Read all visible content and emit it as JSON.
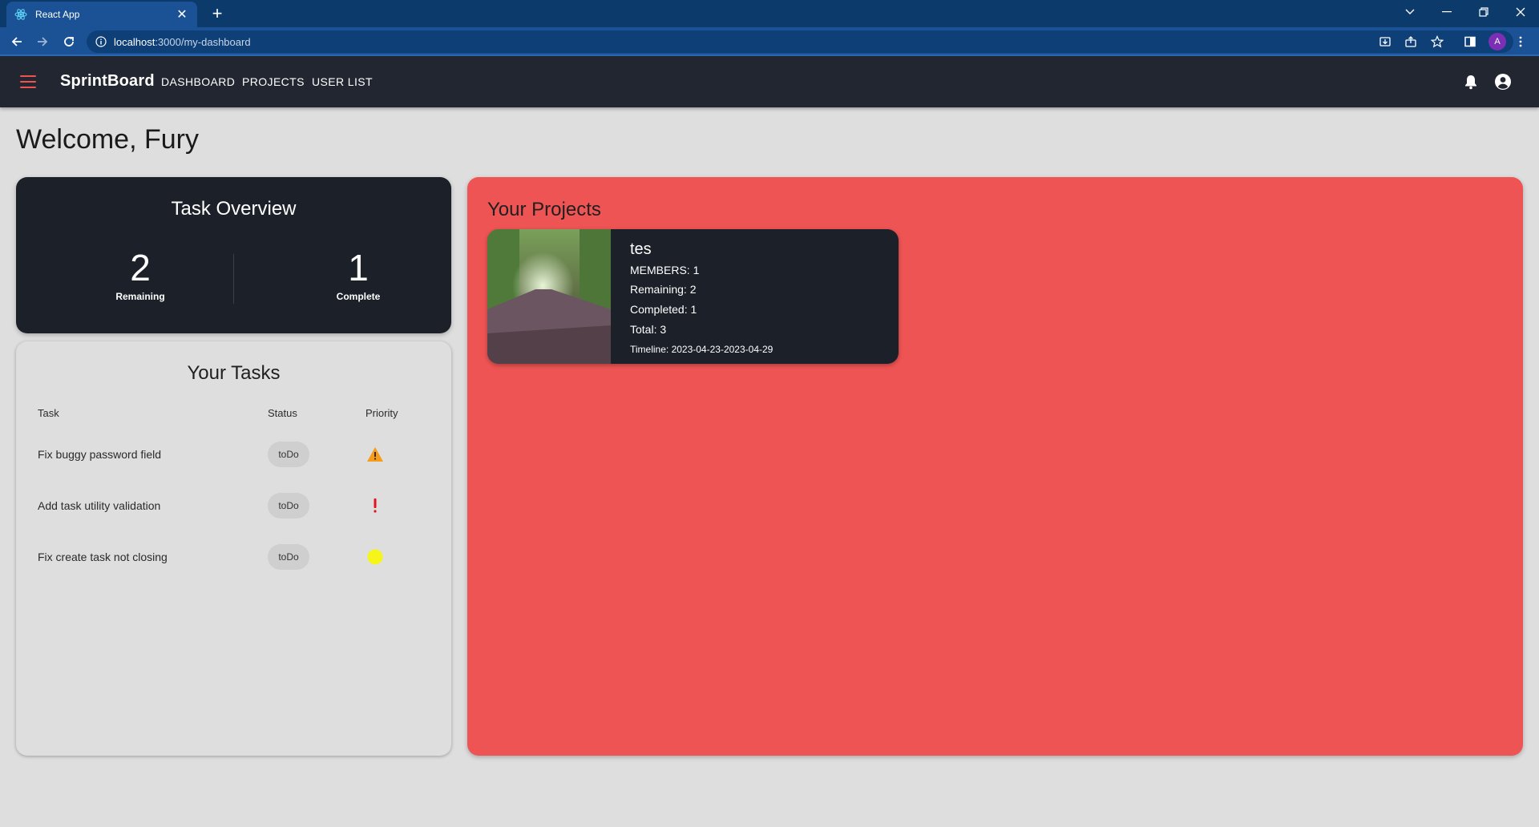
{
  "browser": {
    "tab_title": "React App",
    "url_host": "localhost",
    "url_path": ":3000/my-dashboard",
    "profile_initial": "A"
  },
  "appbar": {
    "brand": "SprintBoard",
    "nav": [
      "DASHBOARD",
      "PROJECTS",
      "USER LIST"
    ]
  },
  "welcome": "Welcome, Fury",
  "overview": {
    "title": "Task Overview",
    "remaining_value": "2",
    "remaining_label": "Remaining",
    "complete_value": "1",
    "complete_label": "Complete"
  },
  "tasks": {
    "title": "Your Tasks",
    "headers": [
      "Task",
      "Status",
      "Priority"
    ],
    "rows": [
      {
        "name": "Fix buggy password field",
        "status": "toDo",
        "priority": "warning-icon"
      },
      {
        "name": "Add task utility validation",
        "status": "toDo",
        "priority": "exclamation-icon"
      },
      {
        "name": "Fix create task not closing",
        "status": "toDo",
        "priority": "yellow-circle-icon"
      }
    ]
  },
  "projects": {
    "title": "Your Projects",
    "items": [
      {
        "name": "tes",
        "members": "MEMBERS: 1",
        "remaining": "Remaining: 2",
        "completed": "Completed: 1",
        "total": "Total: 3",
        "timeline": "Timeline: 2023-04-23-2023-04-29"
      }
    ]
  },
  "colors": {
    "appbar": "#212630",
    "accent_red": "#ef5454",
    "card_dark": "#1b2029",
    "browser_blue": "#1b5296"
  }
}
